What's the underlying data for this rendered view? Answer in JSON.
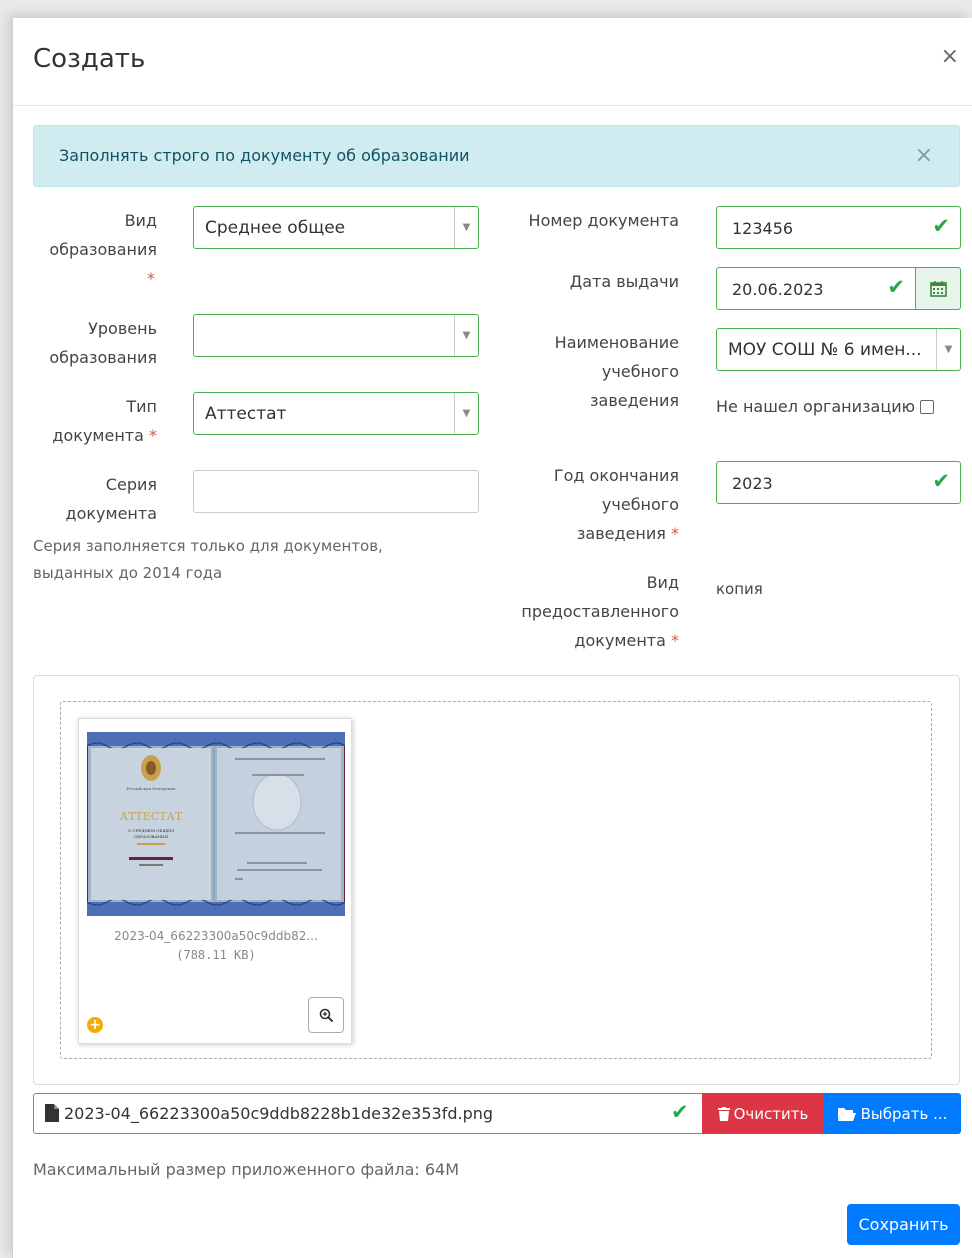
{
  "modal": {
    "title": "Создать",
    "close": "×"
  },
  "alert": {
    "text": "Заполнять строго по документу об образовании",
    "close": "×"
  },
  "form": {
    "edu_type": {
      "label_line1": "Вид",
      "label_line2": "образования",
      "required": "*",
      "value": "Среднее общее"
    },
    "edu_level": {
      "label_line1": "Уровень",
      "label_line2": "образования",
      "value": ""
    },
    "doc_type": {
      "label_line1": "Тип",
      "label_line2": "документа",
      "required": "*",
      "value": "Аттестат"
    },
    "doc_series": {
      "label_line1": "Серия",
      "label_line2": "документа",
      "value": ""
    },
    "series_help": "Серия заполняется только для документов, выданных до 2014 года",
    "doc_number": {
      "label": "Номер документа",
      "value": "123456"
    },
    "issue_date": {
      "label": "Дата выдачи",
      "value": "20.06.2023"
    },
    "institution": {
      "label_line1": "Наименование",
      "label_line2": "учебного",
      "label_line3": "заведения",
      "value": "МОУ СОШ № 6 имен..."
    },
    "not_found_org": {
      "label": "Не нашел организацию",
      "checked": false
    },
    "grad_year": {
      "label_line1": "Год окончания",
      "label_line2": "учебного",
      "label_line3": "заведения",
      "required": "*",
      "value": "2023"
    },
    "provided_doc": {
      "label_line1": "Вид",
      "label_line2": "предоставленного",
      "label_line3": "документа",
      "required": "*",
      "value": "копия"
    }
  },
  "upload": {
    "thumb_name": "2023-04_66223300a50c9ddb82...",
    "thumb_size": "(788.11 KB)",
    "file_name": "2023-04_66223300a50c9ddb8228b1de32e353fd.png",
    "clear_label": "Очистить",
    "choose_label": "Выбрать ...",
    "max_size": "Максимальный размер приложенного файла: 64M"
  },
  "certificate": {
    "header": "Российская Федерация",
    "title": "АТТЕСТАТ",
    "subtitle_1": "О СРЕДНЕМ ОБЩЕМ",
    "subtitle_2": "ОБРАЗОВАНИИ"
  },
  "save_label": "Сохранить",
  "colors": {
    "success": "#28a745",
    "danger": "#dc3545",
    "primary": "#007bff",
    "info_bg": "#d1ecf1"
  }
}
